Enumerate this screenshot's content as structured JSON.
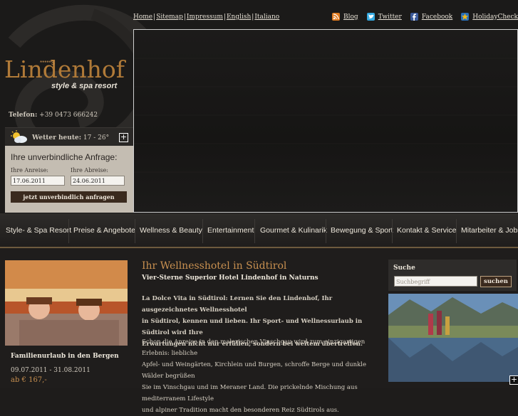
{
  "topnav": {
    "links": [
      "Home",
      "Sitemap",
      "Impressum",
      "English",
      "Italiano"
    ],
    "separator": "|"
  },
  "social": {
    "items": [
      {
        "label": "Blog",
        "icon": "rss-icon",
        "color": "#e07a1f"
      },
      {
        "label": "Twitter",
        "icon": "twitter-icon",
        "color": "#35a9e0"
      },
      {
        "label": "Facebook",
        "icon": "facebook-icon",
        "color": "#3b5998"
      },
      {
        "label": "HolidayCheck",
        "icon": "holidaycheck-icon",
        "color": "#f2b816"
      }
    ]
  },
  "brand": {
    "name": "Lindenhof",
    "stars": "*****S",
    "tagline": "style & spa resort",
    "color": "#b07a38"
  },
  "contact": {
    "phone_label": "Telefon:",
    "phone": "+39 0473 666242"
  },
  "weather": {
    "label": "Wetter heute:",
    "value": "17 - 26°",
    "expand": "+"
  },
  "inquiry": {
    "title": "Ihre unverbindliche Anfrage:",
    "arrival_label": "Ihre Anreise:",
    "arrival_value": "17.06.2011",
    "departure_label": "Ihre Abreise:",
    "departure_value": "24.06.2011",
    "submit": "jetzt unverbindlich anfragen"
  },
  "menu": {
    "items": [
      "Style- & Spa Resort",
      "Preise & Angebote",
      "Wellness & Beauty",
      "Entertainment",
      "Gourmet & Kulinarik",
      "Bewegung & Sport",
      "Kontakt & Service",
      "Mitarbeiter & Jobs"
    ]
  },
  "promo": {
    "title": "Familienurlaub in den Bergen",
    "dates": "09.07.2011 - 31.08.2011",
    "price": "ab € 167,-"
  },
  "main": {
    "heading": "Ihr Wellnesshotel in Südtirol",
    "subheading": "Vier-Sterne Superior Hotel Lindenhof in Naturns",
    "para1_lines": [
      "La Dolce Vita in Südtirol: Lernen Sie den Lindenhof, Ihr ausgezeichnetes Wellnesshotel",
      "in Südtirol, kennen und lieben. Ihr Sport- und Wellnessurlaub in Südtirol wird Ihre",
      "Erwartungen nicht nur erfüllen, sondern bei weitem übertreffen."
    ],
    "para2_lines": [
      "Schon die Anreise in den malerischen Vinschgau wird zum einzigartigen Erlebnis: liebliche",
      "Apfel- und Weingärten, Kirchlein und Burgen, schroffe Berge und dunkle Wälder begrüßen",
      "Sie im Vinschgau und im Meraner Land. Die prickelnde Mischung aus mediterranem Lifestyle",
      "und alpiner Tradition macht den besonderen Reiz Südtirols aus."
    ]
  },
  "search": {
    "label": "Suche",
    "placeholder": "Suchbegriff",
    "button": "suchen"
  },
  "sidebar": {
    "expand": "+"
  },
  "colors": {
    "accent": "#c89050",
    "button_bg": "#3a2a1e",
    "panel": "#c4bdb2"
  }
}
